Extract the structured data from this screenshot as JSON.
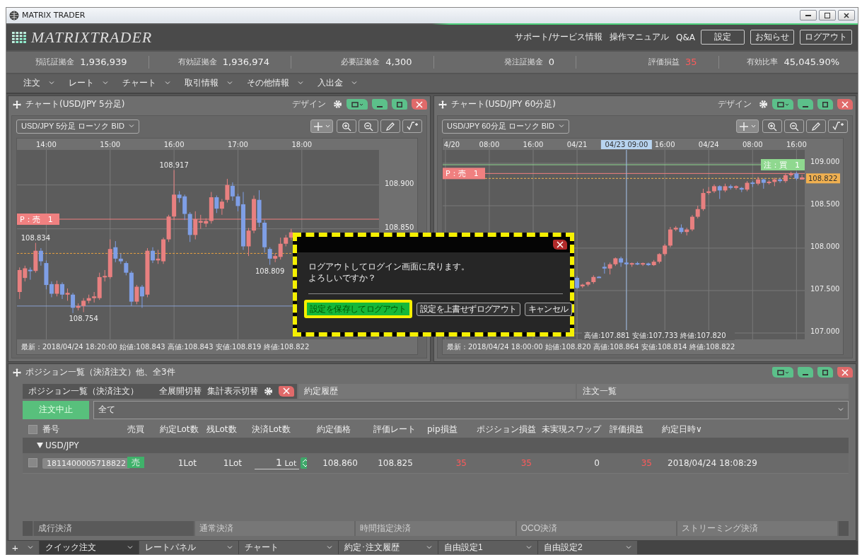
{
  "window": {
    "title": "MATRIX TRADER"
  },
  "header": {
    "logo": "MATRIXTRADER",
    "links": [
      "サポート/サービス情報",
      "操作マニュアル",
      "Q&A"
    ],
    "buttons": [
      "設定",
      "お知らせ",
      "ログアウト"
    ]
  },
  "account": [
    {
      "label": "預託証拠金",
      "value": "1,936,939",
      "kind": "plain"
    },
    {
      "label": "有効証拠金",
      "value": "1,936,974",
      "kind": "plain"
    },
    {
      "label": "必要証拠金",
      "value": "4,300",
      "kind": "plain"
    },
    {
      "label": "発注証拠金",
      "value": "0",
      "kind": "plain"
    },
    {
      "label": "評価損益",
      "value": "35",
      "kind": "profit"
    },
    {
      "label": "有効比率",
      "value": "45,045.90%",
      "kind": "plain"
    }
  ],
  "menu": [
    "注文",
    "レート",
    "チャート",
    "取引情報",
    "その他情報",
    "入出金"
  ],
  "charts": [
    {
      "title": "チャート(USD/JPY 5分足)",
      "design": "デザイン",
      "selector": "USD/JPY 5分足 ローソク BID",
      "footer": "最新：2018/04/24 18:20:00 始値:108.843 高値:108.843 安値:108.819 終値:108.822",
      "line_tags": [
        {
          "kind": "position",
          "text": "P：売　1"
        },
        {
          "kind": "current"
        }
      ],
      "price_labels": [
        {
          "kind": "high",
          "text": "108.917"
        },
        {
          "kind": "high",
          "text": "108.834"
        },
        {
          "kind": "low",
          "text": "108.809"
        },
        {
          "kind": "low",
          "text": "108.754"
        }
      ],
      "chart_data": {
        "type": "candlestick",
        "grid": true,
        "ylim": [
          108.724,
          108.94
        ],
        "categories": [
          null,
          null,
          null,
          null,
          null,
          "14:00",
          null,
          null,
          null,
          null,
          null,
          null,
          null,
          null,
          null,
          null,
          null,
          "15:00",
          null,
          null,
          null,
          null,
          null,
          null,
          null,
          null,
          null,
          null,
          null,
          "16:00",
          null,
          null,
          null,
          null,
          null,
          null,
          null,
          null,
          null,
          null,
          null,
          "17:00",
          null,
          null,
          null,
          null,
          null,
          null,
          null,
          null,
          null,
          null,
          null,
          "18:00",
          null,
          null,
          null,
          null,
          null,
          null,
          null,
          null,
          null,
          null,
          null,
          null,
          null,
          null
        ],
        "yticks": [
          {
            "value": 108.9,
            "label": "108.900"
          },
          {
            "value": 108.85,
            "label": "108.850"
          }
        ],
        "ohlc": [
          [
            108.778,
            108.806,
            108.77,
            108.803
          ],
          [
            108.794,
            108.808,
            108.79,
            108.805
          ],
          [
            108.803,
            108.806,
            108.792,
            108.802
          ],
          [
            108.802,
            108.834,
            108.8,
            108.825
          ],
          [
            108.825,
            108.828,
            108.808,
            108.813
          ],
          [
            108.811,
            108.814,
            108.781,
            108.786
          ],
          [
            108.787,
            108.79,
            108.772,
            108.776
          ],
          [
            108.776,
            108.791,
            108.773,
            108.787
          ],
          [
            108.787,
            108.789,
            108.77,
            108.775
          ],
          [
            108.775,
            108.782,
            108.768,
            108.777
          ],
          [
            108.775,
            108.777,
            108.754,
            108.76
          ],
          [
            108.76,
            108.765,
            108.757,
            108.762
          ],
          [
            108.762,
            108.771,
            108.755,
            108.768
          ],
          [
            108.768,
            108.775,
            108.765,
            108.771
          ],
          [
            108.771,
            108.778,
            108.766,
            108.773
          ],
          [
            108.771,
            108.8,
            108.769,
            108.795
          ],
          [
            108.795,
            108.803,
            108.79,
            108.796
          ],
          [
            108.795,
            108.838,
            108.793,
            108.827
          ],
          [
            108.829,
            108.836,
            108.812,
            108.816
          ],
          [
            108.816,
            108.822,
            108.81,
            108.813
          ],
          [
            108.811,
            108.813,
            108.797,
            108.8
          ],
          [
            108.8,
            108.802,
            108.762,
            108.767
          ],
          [
            108.767,
            108.786,
            108.764,
            108.784
          ],
          [
            108.784,
            108.786,
            108.76,
            108.773
          ],
          [
            108.775,
            108.828,
            108.772,
            108.825
          ],
          [
            108.825,
            108.829,
            108.811,
            108.814
          ],
          [
            108.814,
            108.826,
            108.81,
            108.816
          ],
          [
            108.813,
            108.84,
            108.81,
            108.838
          ],
          [
            108.838,
            108.866,
            108.835,
            108.864
          ],
          [
            108.864,
            108.917,
            108.86,
            108.889
          ],
          [
            108.889,
            108.893,
            108.88,
            108.885
          ],
          [
            108.887,
            108.889,
            108.86,
            108.867
          ],
          [
            108.867,
            108.869,
            108.835,
            108.843
          ],
          [
            108.843,
            108.87,
            108.838,
            108.861
          ],
          [
            108.857,
            108.866,
            108.85,
            108.859
          ],
          [
            108.856,
            108.862,
            108.852,
            108.859
          ],
          [
            108.859,
            108.892,
            108.856,
            108.886
          ],
          [
            108.886,
            108.888,
            108.868,
            108.873
          ],
          [
            108.873,
            108.884,
            108.866,
            108.881
          ],
          [
            108.883,
            108.907,
            108.88,
            108.9
          ],
          [
            108.899,
            108.903,
            108.882,
            108.887
          ],
          [
            108.887,
            108.89,
            108.87,
            108.876
          ],
          [
            108.878,
            108.892,
            108.826,
            108.83
          ],
          [
            108.83,
            108.851,
            108.819,
            108.848
          ],
          [
            108.848,
            108.888,
            108.845,
            108.884
          ],
          [
            108.883,
            108.894,
            108.852,
            108.857
          ],
          [
            108.857,
            108.86,
            108.823,
            108.829
          ],
          [
            108.827,
            108.829,
            108.809,
            108.816
          ],
          [
            108.816,
            108.822,
            108.812,
            108.819
          ],
          [
            108.818,
            108.84,
            108.815,
            108.833
          ],
          [
            108.833,
            108.843,
            108.83,
            108.84
          ],
          [
            108.84,
            108.85,
            108.837,
            108.846
          ],
          null,
          null,
          null,
          null,
          null,
          null,
          null,
          null,
          null,
          null,
          null,
          null,
          null,
          null,
          null,
          null
        ],
        "ref_lines": [
          {
            "axis": "y",
            "value": 108.861,
            "color": "#f08080"
          },
          {
            "axis": "y",
            "value": 108.822,
            "color": "#e8a040"
          },
          {
            "axis": "y",
            "value": 108.762,
            "color": "#8aa0d0"
          }
        ]
      }
    },
    {
      "title": "チャート(USD/JPY 60分足)",
      "design": "デザイン",
      "selector": "USD/JPY 60分足 ローソク BID",
      "hover_info": "高値:107.881 安値:107.733 終値:107.820",
      "footer": "最新：2018/04/24 18:00:00 始値:108.820 高値:108.864 安値:108.814 終値:108.822",
      "line_tags": [
        {
          "kind": "order",
          "text": "注：買　1"
        },
        {
          "kind": "position",
          "text": "P：売　1"
        },
        {
          "kind": "current",
          "text": "108.822"
        }
      ],
      "chart_data": {
        "type": "candlestick",
        "grid": true,
        "ylim": [
          106.925,
          109.158
        ],
        "categories": [
          "4/20",
          null,
          null,
          null,
          null,
          null,
          null,
          null,
          "08:00",
          null,
          null,
          null,
          null,
          null,
          null,
          null,
          "16:00",
          null,
          null,
          null,
          null,
          null,
          null,
          null,
          "04/21",
          null,
          null,
          null,
          null,
          null,
          null,
          null,
          null,
          "04/23 09:00",
          null,
          null,
          null,
          null,
          null,
          null,
          "16:00",
          null,
          null,
          null,
          null,
          null,
          null,
          null,
          "04/24",
          null,
          null,
          null,
          null,
          null,
          null,
          null,
          "08:00",
          null,
          null,
          null,
          null,
          null,
          null,
          null,
          "16:00",
          null
        ],
        "yticks": [
          {
            "value": 109,
            "label": "109.000"
          },
          {
            "value": 108.5,
            "label": "108.500"
          },
          {
            "value": 108,
            "label": "108.000"
          },
          {
            "value": 107.5,
            "label": "107.500"
          },
          {
            "value": 107,
            "label": "107.000"
          }
        ],
        "ohlc": [
          null,
          null,
          null,
          null,
          null,
          null,
          null,
          null,
          null,
          null,
          null,
          null,
          null,
          null,
          null,
          null,
          null,
          null,
          null,
          null,
          null,
          null,
          null,
          null,
          [
            107.65,
            107.67,
            107.52,
            107.53
          ],
          [
            107.55,
            107.58,
            107.53,
            107.57
          ],
          [
            107.57,
            107.61,
            107.55,
            107.6
          ],
          [
            107.6,
            107.68,
            107.58,
            107.66
          ],
          [
            107.66,
            107.67,
            107.65,
            107.65
          ],
          [
            107.78,
            107.83,
            107.7,
            107.76
          ],
          [
            107.76,
            107.83,
            107.69,
            107.81
          ],
          [
            107.81,
            107.89,
            107.79,
            107.88
          ],
          [
            107.88,
            107.9,
            107.78,
            107.83
          ],
          [
            107.83,
            107.88,
            107.8,
            107.81
          ],
          [
            107.81,
            107.83,
            107.78,
            107.82
          ],
          [
            107.82,
            107.84,
            107.8,
            107.81
          ],
          [
            107.81,
            107.83,
            107.79,
            107.82
          ],
          [
            107.82,
            107.83,
            107.79,
            107.8
          ],
          [
            107.8,
            107.86,
            107.79,
            107.84
          ],
          [
            107.84,
            107.94,
            107.82,
            107.93
          ],
          [
            107.93,
            108.05,
            107.91,
            108.03
          ],
          [
            108.03,
            108.25,
            108.01,
            108.22
          ],
          [
            108.22,
            108.26,
            108.2,
            108.24
          ],
          [
            108.24,
            108.28,
            108.17,
            108.19
          ],
          [
            108.19,
            108.24,
            108.15,
            108.22
          ],
          [
            108.22,
            108.39,
            108.2,
            108.37
          ],
          [
            108.37,
            108.5,
            108.35,
            108.46
          ],
          [
            108.46,
            108.7,
            108.44,
            108.65
          ],
          [
            108.65,
            108.72,
            108.63,
            108.67
          ],
          [
            108.67,
            108.75,
            108.65,
            108.73
          ],
          [
            108.73,
            108.74,
            108.58,
            108.68
          ],
          [
            108.68,
            108.76,
            108.66,
            108.73
          ],
          [
            108.73,
            108.75,
            108.69,
            108.71
          ],
          [
            108.71,
            108.74,
            108.69,
            108.73
          ],
          [
            108.71,
            108.72,
            108.66,
            108.69
          ],
          [
            108.69,
            108.79,
            108.67,
            108.77
          ],
          [
            108.77,
            108.79,
            108.72,
            108.76
          ],
          [
            108.76,
            108.84,
            108.74,
            108.81
          ],
          [
            108.81,
            108.82,
            108.7,
            108.77
          ],
          [
            108.77,
            108.8,
            108.75,
            108.78
          ],
          [
            108.78,
            108.83,
            108.73,
            108.81
          ],
          [
            108.81,
            108.83,
            108.77,
            108.79
          ],
          [
            108.79,
            108.88,
            108.77,
            108.86
          ],
          [
            108.86,
            108.9,
            108.84,
            108.88
          ],
          [
            108.88,
            108.9,
            108.8,
            108.82
          ],
          [
            108.82,
            108.864,
            108.814,
            108.822
          ]
        ],
        "ref_lines": [
          {
            "axis": "y",
            "value": 108.983,
            "color": "#8fd88f"
          },
          {
            "axis": "y",
            "value": 108.88,
            "color": "#f08080"
          },
          {
            "axis": "y",
            "value": 108.822,
            "color": "#f0b050"
          },
          {
            "axis": "x",
            "value": "04/23 09:00",
            "color": "#9ab8e0"
          }
        ]
      }
    }
  ],
  "dialog": {
    "message": [
      "ログアウトしてログイン画面に戻ります。",
      "よろしいですか？"
    ],
    "buttons": [
      {
        "label": "設定を保存してログアウト",
        "highlighted": true
      },
      {
        "label": "設定を上書せずログアウト",
        "highlighted": false
      },
      {
        "label": "キャンセル",
        "highlighted": false
      }
    ]
  },
  "positions": {
    "title": "ポジション一覧（決済注文）他、全3件",
    "tabs": [
      {
        "label": "ポジション一覧（決済注文）",
        "selected": true,
        "tools": [
          "全展開切替",
          "集計表示切替"
        ]
      },
      {
        "label": "約定履歴",
        "selected": false
      },
      {
        "label": "注文一覧",
        "selected": false
      }
    ],
    "cancel_button": "注文中止",
    "filter": "全て",
    "select_all_checked": false,
    "columns": [
      "番号",
      "売買",
      "約定Lot数",
      "残Lot数",
      "決済Lot数",
      "約定価格",
      "評価レート",
      "pip損益",
      "ポジション損益",
      "未実現スワップ",
      "評価損益",
      "約定日時∨"
    ],
    "groups": [
      {
        "name": "USD/JPY",
        "expanded": true,
        "rows": [
          {
            "checked": false,
            "id": "1811400005718822",
            "side": "売",
            "lots": "1Lot",
            "remaining": "1Lot",
            "close_lots": "1",
            "close_unit": "Lot",
            "price": "108.860",
            "rate": "108.825",
            "pips": "35",
            "pl": "35",
            "swap": "0",
            "eval": "35",
            "time": "2018/04/24 18:08:29"
          }
        ]
      }
    ],
    "actions": [
      {
        "label": "成行決済",
        "disabled": true
      },
      {
        "label": "通常決済",
        "disabled": true
      },
      {
        "label": "時間指定決済",
        "disabled": true
      },
      {
        "label": "OCO決済",
        "disabled": true
      },
      {
        "label": "ストリーミング決済",
        "disabled": true
      }
    ]
  },
  "bottom_tabs": {
    "add": "+",
    "tabs": [
      {
        "label": "クイック注文",
        "selected": true
      },
      {
        "label": "レートパネル",
        "selected": false
      },
      {
        "label": "チャート",
        "selected": false
      },
      {
        "label": "約定･注文履歴",
        "selected": false
      },
      {
        "label": "自由設定1",
        "selected": false
      },
      {
        "label": "自由設定2",
        "selected": false
      }
    ]
  }
}
